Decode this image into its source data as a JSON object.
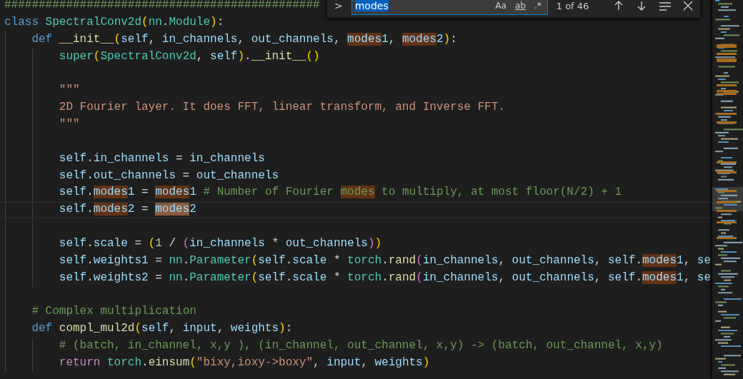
{
  "editor": {
    "lines": [
      {
        "kind": "code",
        "current": false,
        "tokens": [
          {
            "text": "##############################################",
            "kind": "cmt"
          }
        ]
      },
      {
        "kind": "code",
        "current": false,
        "tokens": [
          {
            "text": "class ",
            "kind": "kw"
          },
          {
            "text": "SpectralConv2d",
            "kind": "cls"
          },
          {
            "text": "(",
            "kind": "b1"
          },
          {
            "text": "nn",
            "kind": "cls"
          },
          {
            "text": ".",
            "kind": "op"
          },
          {
            "text": "Module",
            "kind": "cls"
          },
          {
            "text": ")",
            "kind": "b1"
          },
          {
            "text": ":",
            "kind": "op"
          }
        ],
        "children": [
          {
            "kind": "code",
            "current": false,
            "tokens": [
              {
                "text": "def ",
                "kind": "kw"
              },
              {
                "text": "__init__",
                "kind": "fn"
              },
              {
                "text": "(",
                "kind": "b1"
              },
              {
                "text": "self",
                "kind": "var"
              },
              {
                "text": ", ",
                "kind": "op"
              },
              {
                "text": "in_channels",
                "kind": "var"
              },
              {
                "text": ", ",
                "kind": "op"
              },
              {
                "text": "out_channels",
                "kind": "var"
              },
              {
                "text": ", ",
                "kind": "op"
              },
              {
                "text": "modes",
                "kind": "hit"
              },
              {
                "text": "1",
                "kind": "var"
              },
              {
                "text": ", ",
                "kind": "op"
              },
              {
                "text": "modes",
                "kind": "hit"
              },
              {
                "text": "2",
                "kind": "var"
              },
              {
                "text": ")",
                "kind": "b1"
              },
              {
                "text": ":",
                "kind": "op"
              }
            ],
            "children": [
              {
                "kind": "code",
                "current": false,
                "tokens": [
                  {
                    "text": "super",
                    "kind": "cls"
                  },
                  {
                    "text": "(",
                    "kind": "b1"
                  },
                  {
                    "text": "SpectralConv2d",
                    "kind": "cls"
                  },
                  {
                    "text": ", ",
                    "kind": "op"
                  },
                  {
                    "text": "self",
                    "kind": "var"
                  },
                  {
                    "text": ")",
                    "kind": "b1"
                  },
                  {
                    "text": ".",
                    "kind": "op"
                  },
                  {
                    "text": "__init__",
                    "kind": "fn"
                  },
                  {
                    "text": "(",
                    "kind": "b1"
                  },
                  {
                    "text": ")",
                    "kind": "b1"
                  }
                ]
              },
              {
                "kind": "blank",
                "current": false
              },
              {
                "kind": "code",
                "current": false,
                "tokens": [
                  {
                    "text": "\"\"\"",
                    "kind": "str"
                  }
                ]
              },
              {
                "kind": "code",
                "current": false,
                "tokens": [
                  {
                    "text": "2D Fourier layer. It does FFT, linear transform, and Inverse FFT.",
                    "kind": "str"
                  }
                ]
              },
              {
                "kind": "code",
                "current": false,
                "tokens": [
                  {
                    "text": "\"\"\"",
                    "kind": "str"
                  }
                ]
              },
              {
                "kind": "blank",
                "current": false
              },
              {
                "kind": "code",
                "current": false,
                "tokens": [
                  {
                    "text": "self",
                    "kind": "var"
                  },
                  {
                    "text": ".",
                    "kind": "op"
                  },
                  {
                    "text": "in_channels",
                    "kind": "var"
                  },
                  {
                    "text": " = ",
                    "kind": "op"
                  },
                  {
                    "text": "in_channels",
                    "kind": "var"
                  }
                ]
              },
              {
                "kind": "code",
                "current": false,
                "tokens": [
                  {
                    "text": "self",
                    "kind": "var"
                  },
                  {
                    "text": ".",
                    "kind": "op"
                  },
                  {
                    "text": "out_channels",
                    "kind": "var"
                  },
                  {
                    "text": " = ",
                    "kind": "op"
                  },
                  {
                    "text": "out_channels",
                    "kind": "var"
                  }
                ]
              },
              {
                "kind": "code",
                "current": false,
                "tokens": [
                  {
                    "text": "self",
                    "kind": "var"
                  },
                  {
                    "text": ".",
                    "kind": "op"
                  },
                  {
                    "text": "modes",
                    "kind": "hit"
                  },
                  {
                    "text": "1",
                    "kind": "var"
                  },
                  {
                    "text": " = ",
                    "kind": "op"
                  },
                  {
                    "text": "modes",
                    "kind": "hit"
                  },
                  {
                    "text": "1",
                    "kind": "var"
                  },
                  {
                    "text": " # Number of Fourier ",
                    "kind": "cmt"
                  },
                  {
                    "text": "modes",
                    "kind": "hitcmt"
                  },
                  {
                    "text": " to multiply, at most floor(N/2) + 1",
                    "kind": "cmt"
                  }
                ]
              },
              {
                "kind": "code",
                "current": true,
                "tokens": [
                  {
                    "text": "self",
                    "kind": "var"
                  },
                  {
                    "text": ".",
                    "kind": "op"
                  },
                  {
                    "text": "modes",
                    "kind": "hit"
                  },
                  {
                    "text": "2",
                    "kind": "var"
                  },
                  {
                    "text": " = ",
                    "kind": "op"
                  },
                  {
                    "text": "modes",
                    "kind": "curhit"
                  },
                  {
                    "text": "2",
                    "kind": "var"
                  }
                ]
              },
              {
                "kind": "blank",
                "current": false
              },
              {
                "kind": "code",
                "current": false,
                "tokens": [
                  {
                    "text": "self",
                    "kind": "var"
                  },
                  {
                    "text": ".",
                    "kind": "op"
                  },
                  {
                    "text": "scale",
                    "kind": "var"
                  },
                  {
                    "text": " = ",
                    "kind": "op"
                  },
                  {
                    "text": "(",
                    "kind": "b1"
                  },
                  {
                    "text": "1",
                    "kind": "num"
                  },
                  {
                    "text": " / ",
                    "kind": "op"
                  },
                  {
                    "text": "(",
                    "kind": "b2"
                  },
                  {
                    "text": "in_channels",
                    "kind": "var"
                  },
                  {
                    "text": " * ",
                    "kind": "op"
                  },
                  {
                    "text": "out_channels",
                    "kind": "var"
                  },
                  {
                    "text": ")",
                    "kind": "b2"
                  },
                  {
                    "text": ")",
                    "kind": "b1"
                  }
                ]
              },
              {
                "kind": "code",
                "current": false,
                "tokens": [
                  {
                    "text": "self",
                    "kind": "var"
                  },
                  {
                    "text": ".",
                    "kind": "op"
                  },
                  {
                    "text": "weights1",
                    "kind": "var"
                  },
                  {
                    "text": " = ",
                    "kind": "op"
                  },
                  {
                    "text": "nn",
                    "kind": "cls"
                  },
                  {
                    "text": ".",
                    "kind": "op"
                  },
                  {
                    "text": "Parameter",
                    "kind": "cls"
                  },
                  {
                    "text": "(",
                    "kind": "b1"
                  },
                  {
                    "text": "self",
                    "kind": "var"
                  },
                  {
                    "text": ".",
                    "kind": "op"
                  },
                  {
                    "text": "scale",
                    "kind": "var"
                  },
                  {
                    "text": " * ",
                    "kind": "op"
                  },
                  {
                    "text": "torch",
                    "kind": "cls"
                  },
                  {
                    "text": ".",
                    "kind": "op"
                  },
                  {
                    "text": "rand",
                    "kind": "fn"
                  },
                  {
                    "text": "(",
                    "kind": "b2"
                  },
                  {
                    "text": "in_channels",
                    "kind": "var"
                  },
                  {
                    "text": ", ",
                    "kind": "op"
                  },
                  {
                    "text": "out_channels",
                    "kind": "var"
                  },
                  {
                    "text": ", ",
                    "kind": "op"
                  },
                  {
                    "text": "self",
                    "kind": "var"
                  },
                  {
                    "text": ".",
                    "kind": "op"
                  },
                  {
                    "text": "modes",
                    "kind": "hit"
                  },
                  {
                    "text": "1",
                    "kind": "var"
                  },
                  {
                    "text": ", ",
                    "kind": "op"
                  },
                  {
                    "text": "se",
                    "kind": "var"
                  }
                ]
              },
              {
                "kind": "code",
                "current": false,
                "tokens": [
                  {
                    "text": "self",
                    "kind": "var"
                  },
                  {
                    "text": ".",
                    "kind": "op"
                  },
                  {
                    "text": "weights2",
                    "kind": "var"
                  },
                  {
                    "text": " = ",
                    "kind": "op"
                  },
                  {
                    "text": "nn",
                    "kind": "cls"
                  },
                  {
                    "text": ".",
                    "kind": "op"
                  },
                  {
                    "text": "Parameter",
                    "kind": "cls"
                  },
                  {
                    "text": "(",
                    "kind": "b1"
                  },
                  {
                    "text": "self",
                    "kind": "var"
                  },
                  {
                    "text": ".",
                    "kind": "op"
                  },
                  {
                    "text": "scale",
                    "kind": "var"
                  },
                  {
                    "text": " * ",
                    "kind": "op"
                  },
                  {
                    "text": "torch",
                    "kind": "cls"
                  },
                  {
                    "text": ".",
                    "kind": "op"
                  },
                  {
                    "text": "rand",
                    "kind": "fn"
                  },
                  {
                    "text": "(",
                    "kind": "b2"
                  },
                  {
                    "text": "in_channels",
                    "kind": "var"
                  },
                  {
                    "text": ", ",
                    "kind": "op"
                  },
                  {
                    "text": "out_channels",
                    "kind": "var"
                  },
                  {
                    "text": ", ",
                    "kind": "op"
                  },
                  {
                    "text": "self",
                    "kind": "var"
                  },
                  {
                    "text": ".",
                    "kind": "op"
                  },
                  {
                    "text": "modes",
                    "kind": "hit"
                  },
                  {
                    "text": "1",
                    "kind": "var"
                  },
                  {
                    "text": ", ",
                    "kind": "op"
                  },
                  {
                    "text": "se",
                    "kind": "var"
                  }
                ]
              }
            ]
          },
          {
            "kind": "blank",
            "current": false
          },
          {
            "kind": "code",
            "current": false,
            "tokens": [
              {
                "text": "# Complex multiplication",
                "kind": "cmt"
              }
            ]
          },
          {
            "kind": "code",
            "current": false,
            "tokens": [
              {
                "text": "def ",
                "kind": "kw"
              },
              {
                "text": "compl_mul2d",
                "kind": "fn"
              },
              {
                "text": "(",
                "kind": "b1"
              },
              {
                "text": "self",
                "kind": "var"
              },
              {
                "text": ", ",
                "kind": "op"
              },
              {
                "text": "input",
                "kind": "var"
              },
              {
                "text": ", ",
                "kind": "op"
              },
              {
                "text": "weights",
                "kind": "var"
              },
              {
                "text": ")",
                "kind": "b1"
              },
              {
                "text": ":",
                "kind": "op"
              }
            ],
            "children": [
              {
                "kind": "code",
                "current": false,
                "tokens": [
                  {
                    "text": "# (batch, in_channel, x,y ), (in_channel, out_channel, x,y) -> (batch, out_channel, x,y)",
                    "kind": "cmt"
                  }
                ]
              },
              {
                "kind": "code",
                "current": false,
                "tokens": [
                  {
                    "text": "return ",
                    "kind": "ctl"
                  },
                  {
                    "text": "torch",
                    "kind": "cls"
                  },
                  {
                    "text": ".",
                    "kind": "op"
                  },
                  {
                    "text": "einsum",
                    "kind": "fn"
                  },
                  {
                    "text": "(",
                    "kind": "b1"
                  },
                  {
                    "text": "\"bixy,ioxy->boxy\"",
                    "kind": "str"
                  },
                  {
                    "text": ", ",
                    "kind": "op"
                  },
                  {
                    "text": "input",
                    "kind": "var"
                  },
                  {
                    "text": ", ",
                    "kind": "op"
                  },
                  {
                    "text": "weights",
                    "kind": "var"
                  },
                  {
                    "text": ")",
                    "kind": "b1"
                  }
                ]
              }
            ]
          }
        ]
      }
    ]
  },
  "find_widget": {
    "toggle": ">",
    "query": "modes",
    "query_selected": true,
    "options": [
      {
        "label": "Aa",
        "on": false
      },
      {
        "label": "ab",
        "on": false
      },
      {
        "label": ".*",
        "on": false
      }
    ],
    "result": "1 of 46"
  }
}
